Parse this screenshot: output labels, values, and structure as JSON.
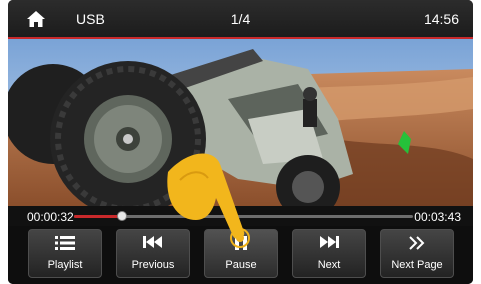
{
  "header": {
    "home_icon": "home-icon",
    "source": "USB",
    "track": "1/4",
    "clock": "14:56"
  },
  "colors": {
    "accent": "#c9292b",
    "bar": "#1c1c1c",
    "button": "#3a3a3a"
  },
  "playback": {
    "current_time": "00:00:32",
    "total_time": "00:03:43",
    "progress": 0.143
  },
  "controls": [
    {
      "label": "Playlist",
      "icon": "playlist-icon"
    },
    {
      "label": "Previous",
      "icon": "previous-icon"
    },
    {
      "label": "Pause",
      "icon": "pause-icon"
    },
    {
      "label": "Next",
      "icon": "next-icon"
    },
    {
      "label": "Next Page",
      "icon": "next-page-icon"
    }
  ]
}
